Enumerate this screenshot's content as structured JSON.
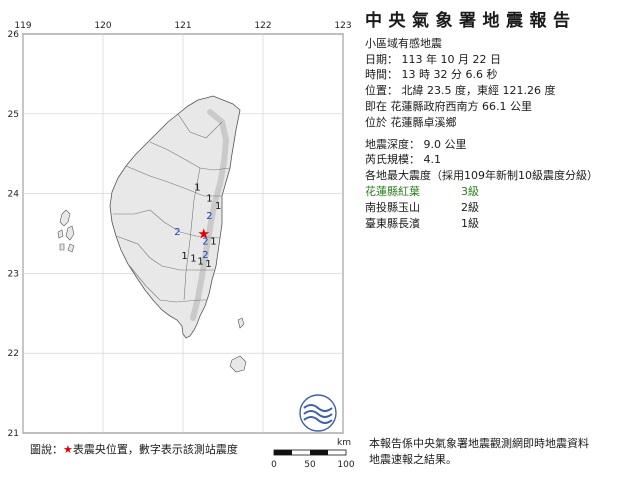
{
  "report": {
    "title": "中央氣象署地震報告",
    "subtitle": "小區域有感地震",
    "date_line": "日期： 113 年 10 月 22 日",
    "time_line": "時間： 13 時 32 分 6.6 秒",
    "position_line": "位置： 北緯 23.5 度，東經 121.26 度",
    "relative_line": "即在 花蓮縣政府西南方 66.1 公里",
    "located_line": "位於 花蓮縣卓溪鄉",
    "depth_line": "地震深度： 9.0 公里",
    "magnitude_line": "芮氏規模： 4.1",
    "intensity_header": "各地最大震度（採用109年新制10級震度分級）",
    "stations": [
      {
        "name": "花蓮縣紅葉",
        "level": "3級",
        "color": "#2e7d1f"
      },
      {
        "name": "南投縣玉山",
        "level": "2級",
        "color": "#1a1a1a"
      },
      {
        "name": "臺東縣長濱",
        "level": "1級",
        "color": "#1a1a1a"
      }
    ],
    "footer_line1": "本報告係中央氣象署地震觀測網即時地震資料",
    "footer_line2": "地震速報之結果。"
  },
  "map": {
    "lon_ticks": [
      "119",
      "120",
      "121",
      "122",
      "123"
    ],
    "lat_ticks": [
      "26",
      "25",
      "24",
      "23",
      "22",
      "21"
    ],
    "epicenter_lon": 121.26,
    "epicenter_lat": 23.5,
    "colors": {
      "ocean": "#ffffff",
      "land": "#e8e8e8",
      "relief": "#bdbdbd",
      "epicenter": "#e00000",
      "intensity_1": "#111111",
      "intensity_2": "#1f3fbf",
      "logo": "#3f5fae"
    },
    "station_labels": [
      {
        "value": "1",
        "lon": 121.18,
        "lat": 24.09,
        "color": "#111111"
      },
      {
        "value": "1",
        "lon": 121.33,
        "lat": 23.95,
        "color": "#111111"
      },
      {
        "value": "1",
        "lon": 121.44,
        "lat": 23.86,
        "color": "#111111"
      },
      {
        "value": "2",
        "lon": 121.33,
        "lat": 23.73,
        "color": "#1f3fbf"
      },
      {
        "value": "2",
        "lon": 120.93,
        "lat": 23.53,
        "color": "#1f3fbf"
      },
      {
        "value": "2",
        "lon": 121.28,
        "lat": 23.41,
        "color": "#1f3fbf"
      },
      {
        "value": "1",
        "lon": 121.38,
        "lat": 23.41,
        "color": "#111111"
      },
      {
        "value": "2",
        "lon": 121.28,
        "lat": 23.24,
        "color": "#1f3fbf"
      },
      {
        "value": "1",
        "lon": 121.02,
        "lat": 23.23,
        "color": "#111111"
      },
      {
        "value": "1",
        "lon": 121.13,
        "lat": 23.2,
        "color": "#111111"
      },
      {
        "value": "1",
        "lon": 121.22,
        "lat": 23.16,
        "color": "#111111"
      },
      {
        "value": "1",
        "lon": 121.32,
        "lat": 23.13,
        "color": "#111111"
      }
    ]
  },
  "legend": {
    "prefix": "圖說：",
    "star": "★",
    "text": "表震央位置，數字表示該測站震度",
    "scale_unit": "km",
    "scale_labels": [
      "0",
      "50",
      "100"
    ]
  }
}
